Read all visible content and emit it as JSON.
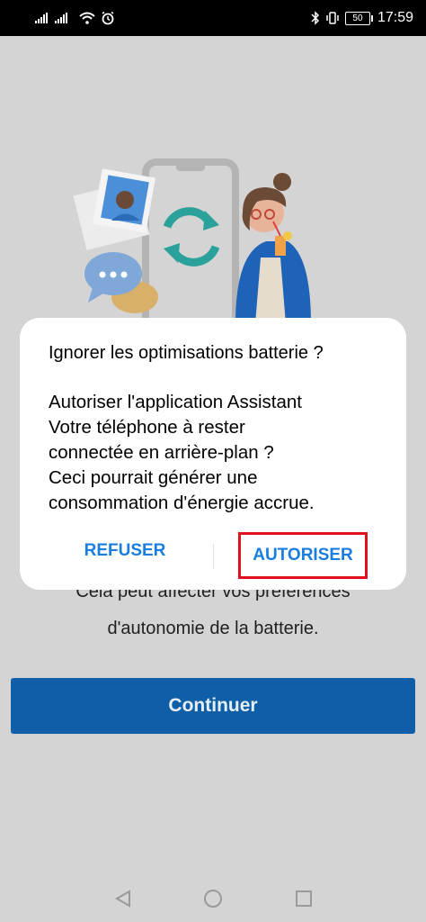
{
  "status_bar": {
    "time": "17:59",
    "battery": "50"
  },
  "background": {
    "text_line_1": "Cela peut affecter vos préférences",
    "text_line_2": "d'autonomie de la batterie.",
    "continue_label": "Continuer"
  },
  "dialog": {
    "title": "Ignorer les optimisations batterie ?",
    "message_lines": [
      "Autoriser l'application Assistant",
      "Votre téléphone à rester",
      "connectée en arrière-plan ?",
      "Ceci pourrait générer une",
      "consommation d'énergie accrue."
    ],
    "refuse_label": "REFUSER",
    "authorize_label": "AUTORISER"
  },
  "colors": {
    "accent": "#1a7de0",
    "primary_button": "#0f5fa8",
    "highlight": "#e0101c"
  },
  "icons": {
    "status_left": [
      "signal-icon",
      "signal-icon",
      "wifi-icon",
      "alarm-icon"
    ],
    "status_right": [
      "bluetooth-icon",
      "vibrate-icon",
      "battery-icon"
    ],
    "nav": [
      "back-icon",
      "home-icon",
      "recent-apps-icon"
    ]
  }
}
